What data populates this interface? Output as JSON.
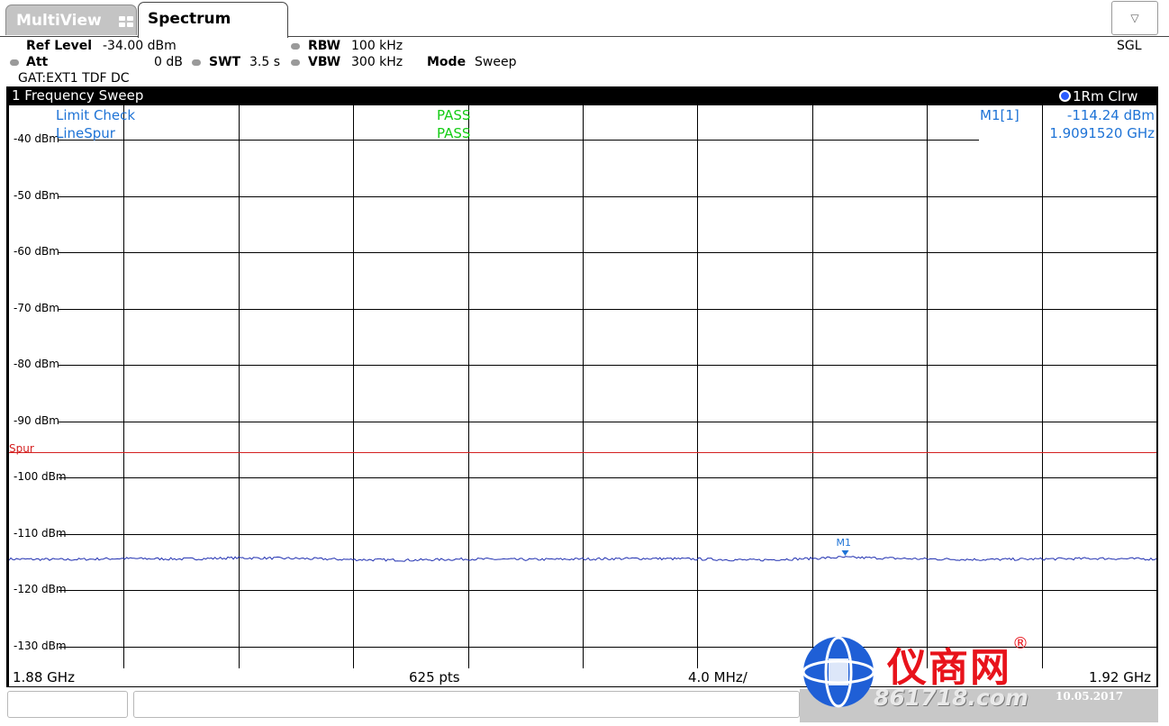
{
  "tabs": {
    "multiview": "MultiView",
    "spectrum": "Spectrum",
    "dropdown_glyph": "▽"
  },
  "settings": {
    "ref_level_label": "Ref Level",
    "ref_level_value": "-34.00 dBm",
    "att_label": "Att",
    "att_value": "0 dB",
    "swt_label": "SWT",
    "swt_value": "3.5 s",
    "rbw_label": "RBW",
    "rbw_value": "100 kHz",
    "vbw_label": "VBW",
    "vbw_value": "300 kHz",
    "mode_label": "Mode",
    "mode_value": "Sweep",
    "gate": "GAT:EXT1 TDF DC",
    "sgl": "SGL"
  },
  "diagram": {
    "title": "1 Frequency Sweep",
    "trace_indicator": "1Rm Clrw",
    "limit_check_label": "Limit Check",
    "limit_check_result": "PASS",
    "line_label": "LineSpur",
    "line_result": "PASS",
    "marker_label": "M1[1]",
    "marker_level": "-114.24 dBm",
    "marker_freq": "1.9091520 GHz",
    "marker_tag": "M1",
    "limit_line_label": "Spur",
    "start_freq": "1.88 GHz",
    "points": "625 pts",
    "span_per_div": "4.0 MHz/",
    "stop_freq": "1.92 GHz"
  },
  "chart_data": {
    "type": "line",
    "y_ticks": [
      "-40 dBm",
      "-50 dBm",
      "-60 dBm",
      "-70 dBm",
      "-80 dBm",
      "-90 dBm",
      "-100 dBm",
      "-110 dBm",
      "-120 dBm",
      "-130 dBm"
    ],
    "ylim": [
      -140,
      -34
    ],
    "xlim": [
      1.88,
      1.92
    ],
    "x_unit": "GHz",
    "grid": true,
    "limit_line": {
      "name": "Spur",
      "value": -95.5,
      "color": "#d42020"
    },
    "series": [
      {
        "color": "#1f2fb0",
        "x": [
          1.88,
          1.882,
          1.884,
          1.886,
          1.888,
          1.89,
          1.892,
          1.894,
          1.896,
          1.898,
          1.9,
          1.902,
          1.904,
          1.906,
          1.908,
          1.909,
          1.91,
          1.912,
          1.914,
          1.916,
          1.918,
          1.92
        ],
        "y": [
          -114.5,
          -114.6,
          -114.4,
          -114.5,
          -114.3,
          -114.4,
          -114.6,
          -114.7,
          -114.5,
          -114.6,
          -114.5,
          -114.4,
          -114.5,
          -114.7,
          -114.4,
          -114.2,
          -114.3,
          -114.5,
          -114.6,
          -114.5,
          -114.4,
          -114.5
        ]
      }
    ],
    "marker": {
      "name": "M1",
      "x": 1.909152,
      "y": -114.24
    }
  },
  "bottom": {
    "date": "10.05.2017"
  },
  "watermark": {
    "text": "仪商网",
    "reg": "®",
    "url": "861718.com"
  }
}
